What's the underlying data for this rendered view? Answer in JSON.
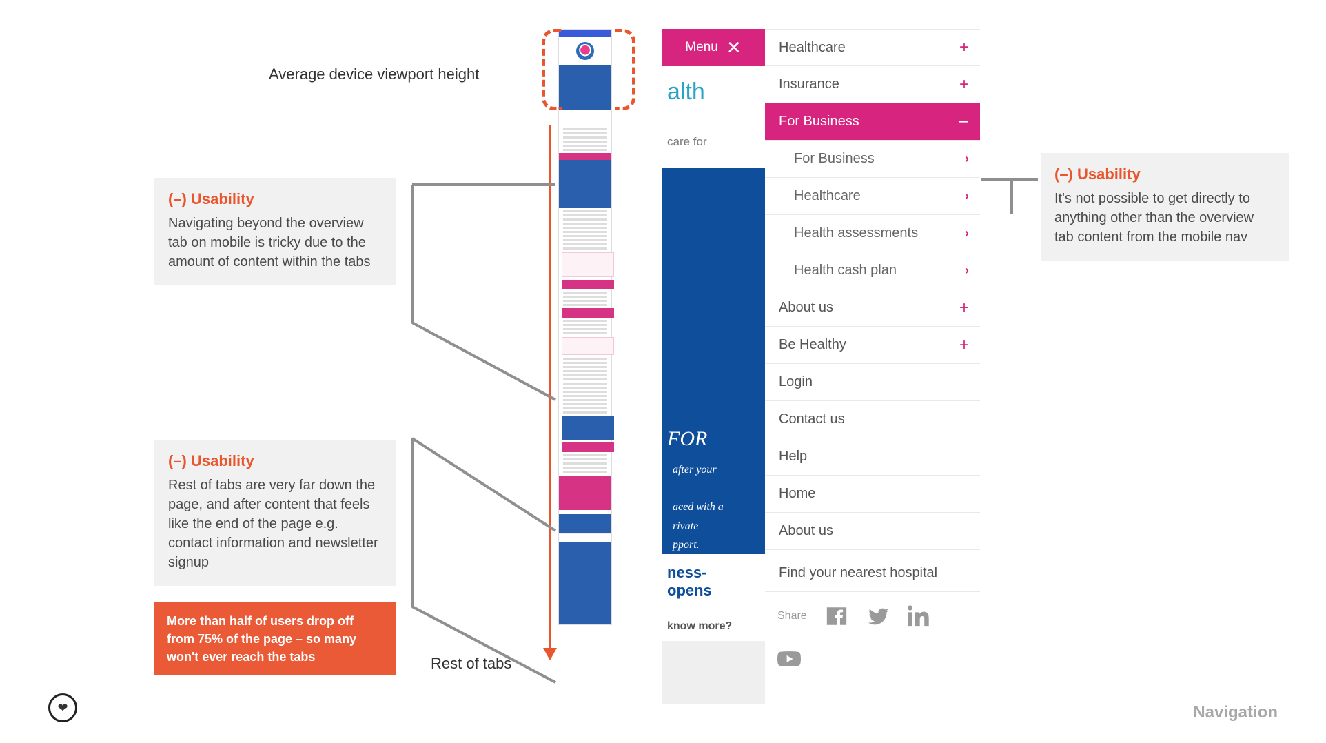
{
  "labels": {
    "viewport": "Average device viewport height",
    "restOfTabs": "Rest of tabs",
    "footer": "Navigation"
  },
  "notes": {
    "n1": {
      "tag": "(–)  Usability",
      "body": "Navigating beyond the overview tab on mobile is tricky due to the amount of content within the tabs"
    },
    "n2": {
      "tag": "(–)  Usability",
      "body": "Rest of tabs are very far down the page, and after content that feels like the end of the page e.g. contact information and newsletter signup"
    },
    "n3": {
      "tag": "(–)  Usability",
      "body": "It's not possible to get directly to anything other than the overview tab content from the mobile nav"
    }
  },
  "warn": "More than half of users drop off from 75% of the page – so many won't ever reach the tabs",
  "mobnav": {
    "menuLabel": "Menu",
    "items": {
      "healthcare": "Healthcare",
      "insurance": "Insurance",
      "forBusiness": "For Business",
      "sub_forBusiness": "For Business",
      "sub_healthcare": "Healthcare",
      "sub_assessments": "Health assessments",
      "sub_cashplan": "Health cash plan",
      "aboutUs": "About us",
      "beHealthy": "Be Healthy",
      "login": "Login",
      "contact": "Contact us",
      "help": "Help",
      "home": "Home",
      "aboutUs2": "About us",
      "findHospital": "Find your nearest hospital"
    },
    "share": "Share"
  },
  "mobunder": {
    "brand": "alth",
    "tagline": "care for",
    "heroLine": "FOR",
    "copy1": "after your",
    "copy2a": "aced with a",
    "copy2b": "rivate",
    "copy2c": "pport.",
    "biz1": "ness-",
    "biz2": "opens",
    "know": "know more?"
  }
}
